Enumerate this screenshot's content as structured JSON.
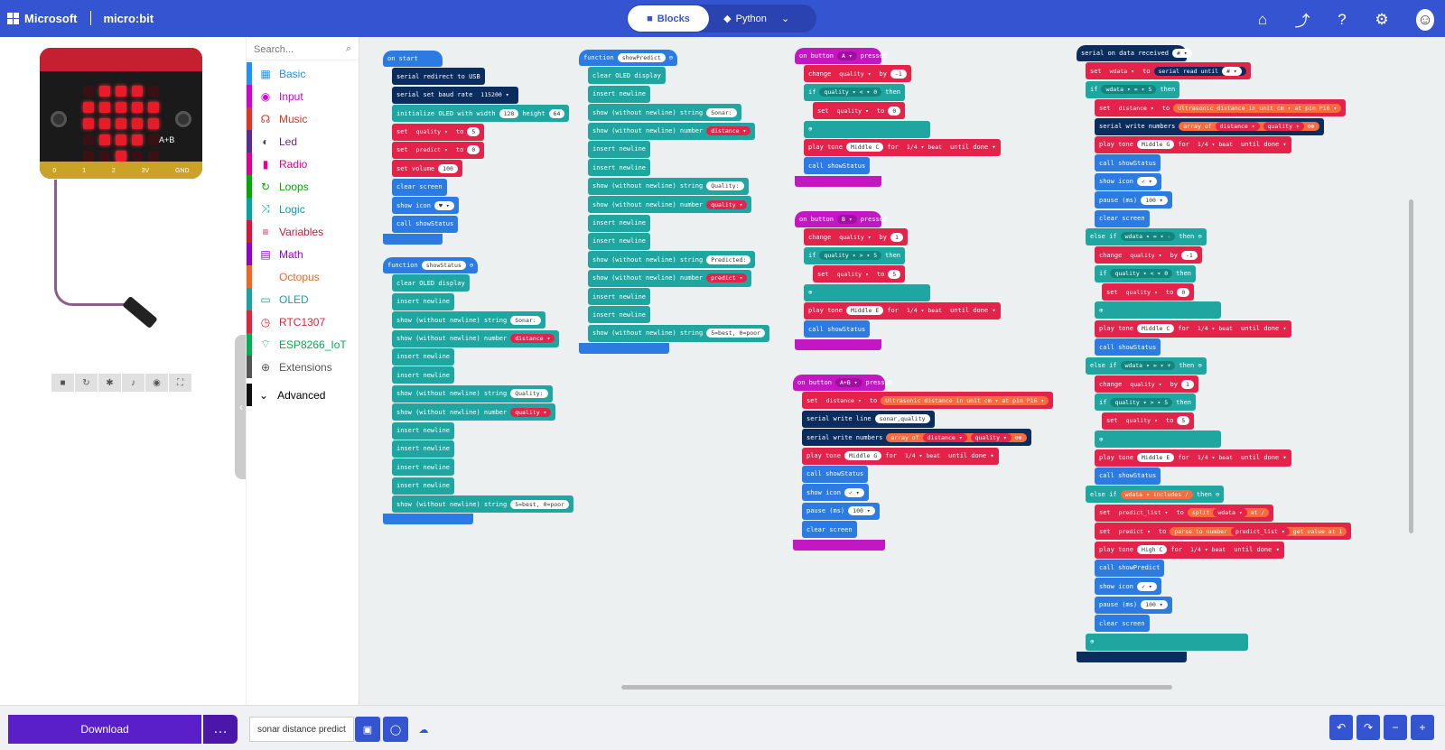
{
  "header": {
    "ms": "Microsoft",
    "mb": "micro:bit",
    "blocks": "Blocks",
    "python": "Python"
  },
  "toolbox": {
    "search_ph": "Search...",
    "cats": [
      {
        "label": "Basic",
        "color": "#1e90ff",
        "icon": "grid"
      },
      {
        "label": "Input",
        "color": "#d400d4",
        "icon": "circle"
      },
      {
        "label": "Music",
        "color": "#e63022",
        "icon": "headphones"
      },
      {
        "label": "Led",
        "color": "#5c2d91",
        "icon": "toggle"
      },
      {
        "label": "Radio",
        "color": "#e3008c",
        "icon": "bars"
      },
      {
        "label": "Loops",
        "color": "#00aa00",
        "icon": "refresh"
      },
      {
        "label": "Logic",
        "color": "#00a4a6",
        "icon": "shuffle"
      },
      {
        "label": "Variables",
        "color": "#dc143c",
        "icon": "lines"
      },
      {
        "label": "Math",
        "color": "#9400d3",
        "icon": "calc"
      },
      {
        "label": "Octopus",
        "color": "#f26522",
        "icon": ""
      },
      {
        "label": "OLED",
        "color": "#1ba1a1",
        "icon": "monitor"
      },
      {
        "label": "RTC1307",
        "color": "#e3233a",
        "icon": "clock"
      },
      {
        "label": "ESP8266_IoT",
        "color": "#00b050",
        "icon": "wifi"
      },
      {
        "label": "Extensions",
        "color": "#555555",
        "icon": "plus"
      }
    ],
    "advanced": "Advanced"
  },
  "pins": [
    "0",
    "1",
    "2",
    "3V",
    "GND"
  ],
  "ab_label": "A+B",
  "footer": {
    "download": "Download",
    "project_name": "sonar distance predictio"
  }
}
